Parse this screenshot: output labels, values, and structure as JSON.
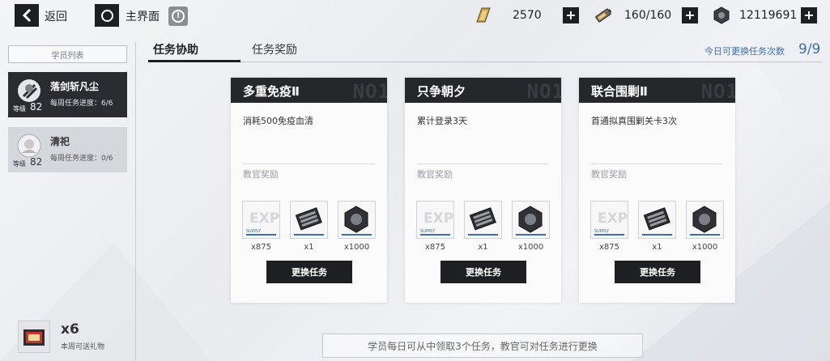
{
  "nav": {
    "back_label": "返回",
    "home_label": "主界面"
  },
  "resources": [
    {
      "icon": "gold-bar-icon",
      "value": "2570"
    },
    {
      "icon": "stamina-battery-icon",
      "value": "160/160"
    },
    {
      "icon": "hex-nut-icon",
      "value": "12119691"
    }
  ],
  "sidebar": {
    "title": "学员列表",
    "level_label": "等级",
    "students": [
      {
        "name": "落剑斩凡尘",
        "level": "82",
        "progress": "每周任务进度：6/6",
        "active": true
      },
      {
        "name": "清祀",
        "level": "82",
        "progress": "每周任务进度：0/6",
        "active": false
      }
    ],
    "gift": {
      "count": "x6",
      "label": "本周可送礼物"
    }
  },
  "tabs": [
    {
      "label": "任务协助",
      "active": true
    },
    {
      "label": "任务奖励",
      "active": false
    }
  ],
  "quota": {
    "label": "今日可更换任务次数",
    "value": "9/9"
  },
  "cards": [
    {
      "title": "多重免疫Ⅱ",
      "number": "NO1",
      "description": "消耗500免疫血清",
      "rewards_label": "教官奖励",
      "rewards": [
        {
          "icon": "exp-supply-icon",
          "qty": "x875"
        },
        {
          "icon": "memory-chip-icon",
          "qty": "x1"
        },
        {
          "icon": "hex-nut-icon",
          "qty": "x1000"
        }
      ],
      "button": "更换任务"
    },
    {
      "title": "只争朝夕",
      "number": "NO1",
      "description": "累计登录3天",
      "rewards_label": "教官奖励",
      "rewards": [
        {
          "icon": "exp-supply-icon",
          "qty": "x875"
        },
        {
          "icon": "memory-chip-icon",
          "qty": "x1"
        },
        {
          "icon": "hex-nut-icon",
          "qty": "x1000"
        }
      ],
      "button": "更换任务"
    },
    {
      "title": "联合围剿Ⅱ",
      "number": "NO1",
      "description": "首通拟真围剿关卡3次",
      "rewards_label": "教官奖励",
      "rewards": [
        {
          "icon": "exp-supply-icon",
          "qty": "x875"
        },
        {
          "icon": "memory-chip-icon",
          "qty": "x1"
        },
        {
          "icon": "hex-nut-icon",
          "qty": "x1000"
        }
      ],
      "button": "更换任务"
    }
  ],
  "footer_note": "学员每日可从中领取3个任务，教官可对任务进行更换"
}
